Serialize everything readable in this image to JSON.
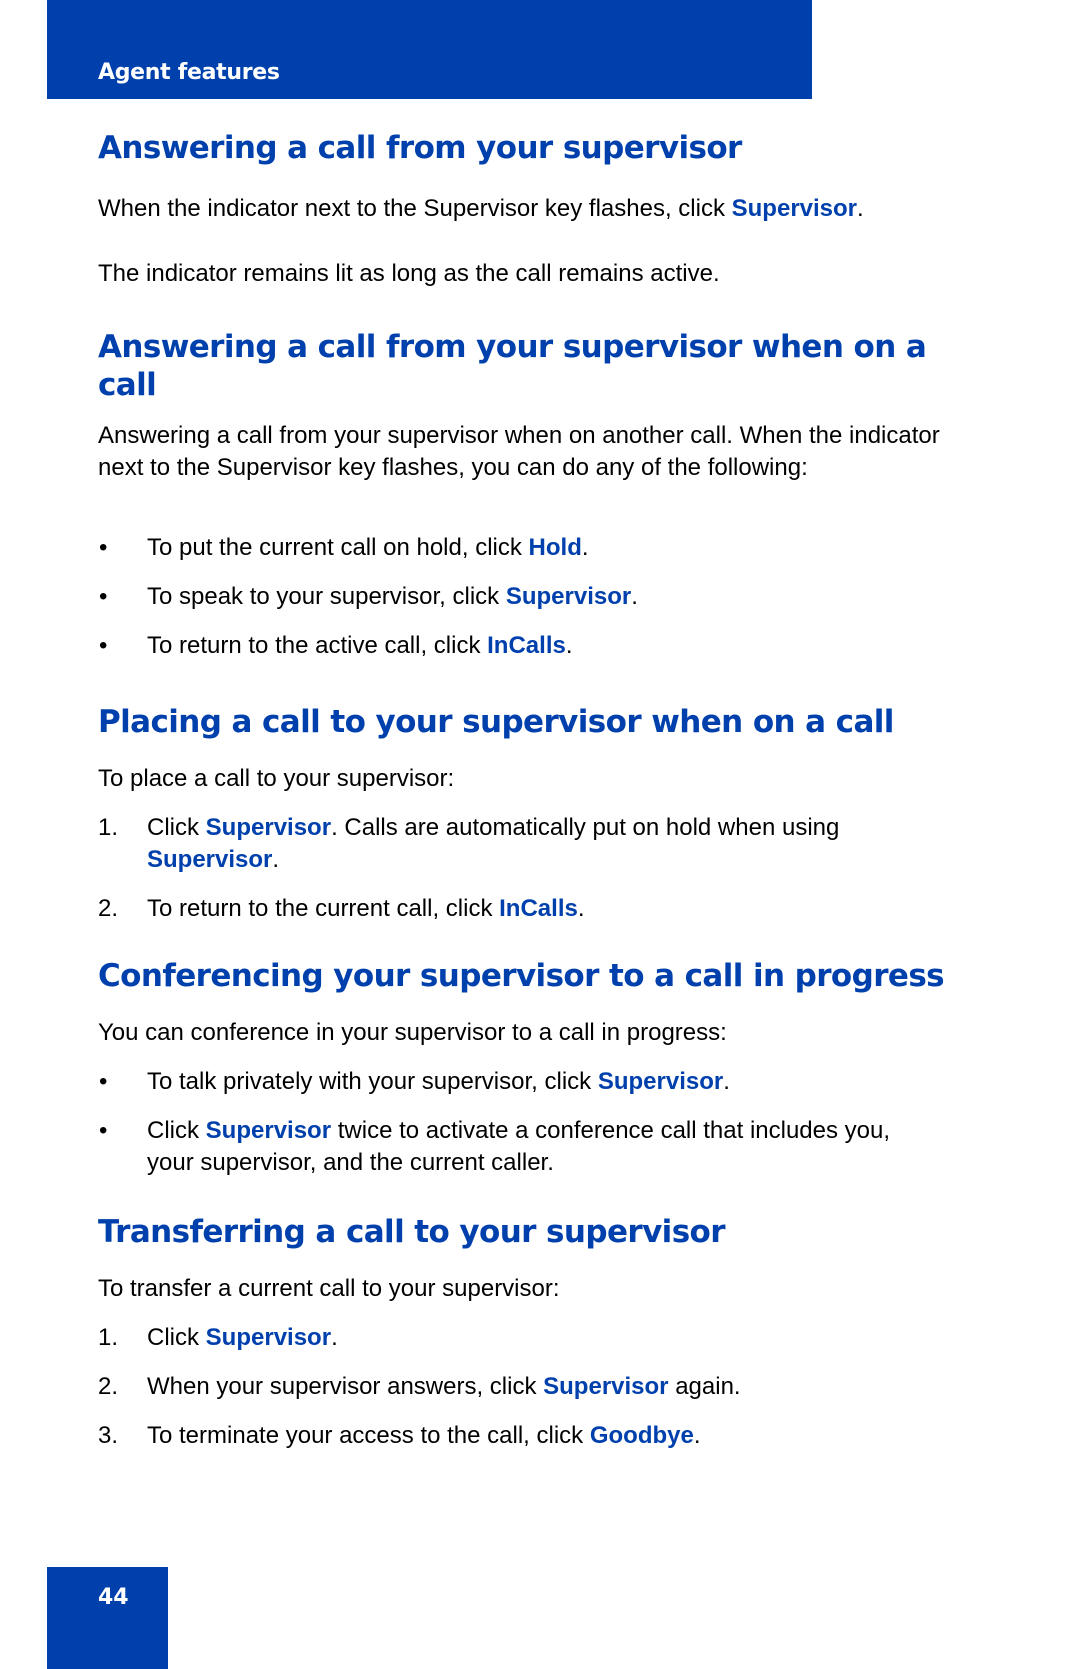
{
  "header": {
    "chapter_title": "Agent features"
  },
  "sections": [
    {
      "title": "Answering a call from your supervisor",
      "paragraphs": [
        {
          "parts": [
            "When the indicator next to the Supervisor key flashes, click ",
            "Supervisor",
            "."
          ]
        },
        {
          "parts": [
            "The indicator remains lit as long as the call remains active."
          ]
        }
      ]
    },
    {
      "title": "Answering a call from your supervisor when on a call",
      "intro": "Answering a call from your supervisor when on another call.  When the indicator next to the Supervisor key flashes, you can do any of the following:",
      "list_type": "bullet",
      "items": [
        {
          "before": "To put the current call on hold, click ",
          "keyword": "Hold",
          "after": "."
        },
        {
          "before": "To speak to your supervisor, click ",
          "keyword": "Supervisor",
          "after": "."
        },
        {
          "before": "To return to the active call, click ",
          "keyword": "InCalls",
          "after": "."
        }
      ]
    },
    {
      "title": "Placing a call to your supervisor when on a call",
      "intro": "To place a call to your supervisor:",
      "list_type": "numbered",
      "items": [
        {
          "marker": "1.",
          "before": "Click ",
          "keyword": "Supervisor",
          "middle": ". Calls are automatically put on hold when using ",
          "keyword2": "Supervisor",
          "after": "."
        },
        {
          "marker": "2.",
          "before": "To return to the current call, click ",
          "keyword": "InCalls",
          "after": "."
        }
      ]
    },
    {
      "title": "Conferencing your supervisor to a call in progress",
      "intro": "You can conference in your supervisor to a call in progress:",
      "list_type": "bullet",
      "items": [
        {
          "before": "To talk privately with your supervisor, click ",
          "keyword": "Supervisor",
          "after": "."
        },
        {
          "before": "Click ",
          "keyword": "Supervisor",
          "after": " twice to activate a conference call that includes you, your supervisor, and the current caller."
        }
      ]
    },
    {
      "title": "Transferring a call to your supervisor",
      "intro": "To transfer a current call to your supervisor:",
      "list_type": "numbered",
      "items": [
        {
          "marker": "1.",
          "before": "Click ",
          "keyword": "Supervisor",
          "after": "."
        },
        {
          "marker": "2.",
          "before": "When your supervisor answers, click ",
          "keyword": "Supervisor",
          "after": " again."
        },
        {
          "marker": "3.",
          "before": "To terminate your access to the call, click ",
          "keyword": "Goodbye",
          "after": "."
        }
      ]
    }
  ],
  "bullet_glyph": "•",
  "footer": {
    "page_number": "44"
  },
  "colors": {
    "brand_blue": "#0040ad",
    "text": "#000000",
    "background": "#ffffff"
  }
}
